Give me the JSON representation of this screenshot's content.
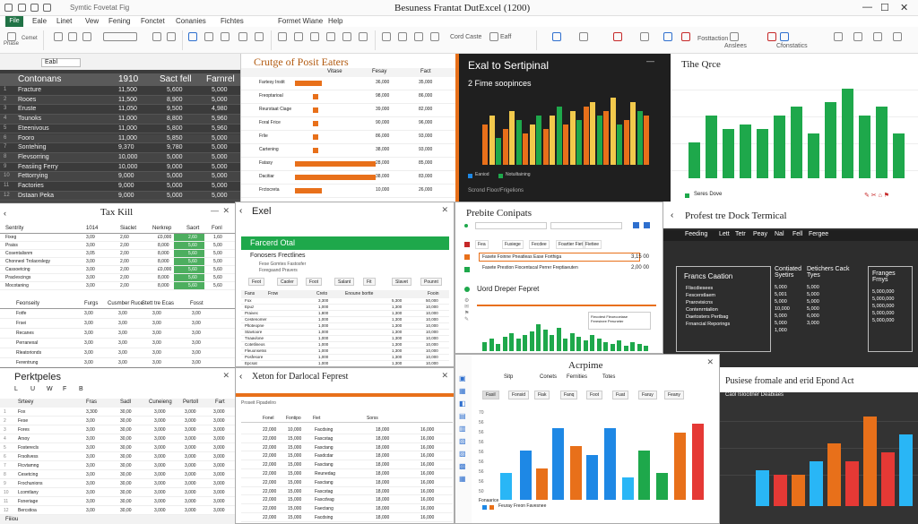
{
  "window": {
    "title": "Besuness Frantat DutExcel (1200)"
  },
  "menu": [
    "Eale",
    "Linet",
    "Vew",
    "Fening",
    "Fonctet",
    "Conanies",
    "Fichtes",
    "Formet Wiane",
    "Help"
  ],
  "menu_file": "File",
  "quick_access": "Symtic Fovetat Fig",
  "ribbon": {
    "left_labels": [
      "Pnase",
      "Cemet"
    ],
    "mid_labels": [
      "Cord Caste",
      "Eaff"
    ],
    "right_labels": [
      "Fosttaction",
      "Anslees",
      "Cfonstatics"
    ]
  },
  "panelA": {
    "name_box": "Eabl",
    "headers": [
      "Contonans",
      "1910",
      "Sact fell",
      "Farnrel"
    ],
    "rows": [
      [
        "Fracture",
        "11,500",
        "5,600",
        "5,000"
      ],
      [
        "Rooes",
        "11,500",
        "8,900",
        "5,000"
      ],
      [
        "Eruste",
        "11,050",
        "9,500",
        "4,980"
      ],
      [
        "Tounoks",
        "11,000",
        "8,800",
        "5,960"
      ],
      [
        "Eteenivous",
        "11,000",
        "5,800",
        "5,960"
      ],
      [
        "Fooro",
        "11,000",
        "5,850",
        "5,000"
      ],
      [
        "Sontehing",
        "9,370",
        "9,780",
        "5,000"
      ],
      [
        "Flevsorring",
        "10,000",
        "5,000",
        "5,000"
      ],
      [
        "Feasiing Ferry",
        "10,000",
        "9,000",
        "5,000"
      ],
      [
        "Fettorrying",
        "9,000",
        "5,000",
        "5,000"
      ],
      [
        "Factories",
        "9,000",
        "5,000",
        "5,000"
      ],
      [
        "Dstaan Peka",
        "9,000",
        "5,000",
        "5,000"
      ]
    ]
  },
  "panelB": {
    "title": "Crutge of Posit Eaters",
    "headers": [
      "Vitase",
      "Fesay",
      "Fact"
    ],
    "rows": [
      [
        "Fartesy Instit",
        "2,00",
        "36,000",
        "35,000"
      ],
      [
        "Freoptarioal",
        "2,00",
        "98,000",
        "86,000"
      ],
      [
        "Reurstaat Ciage",
        "2,00",
        "39,000",
        "82,000"
      ],
      [
        "Foral Frice",
        "2,00",
        "90,000",
        "96,000"
      ],
      [
        "Frlie",
        "2,00",
        "86,000",
        "93,000"
      ],
      [
        "Cartening",
        "2,00",
        "38,000",
        "93,000"
      ],
      [
        "Fatasy",
        "2,00",
        "28,000",
        "85,000"
      ],
      [
        "Dacitiar",
        "2,00",
        "38,000",
        "83,000"
      ],
      [
        "Frctocreta",
        "2,00",
        "10,000",
        "26,000"
      ]
    ]
  },
  "panelC": {
    "title": "Exal to Sertipinal",
    "subtitle": "2 Fime soopinces",
    "legend": [
      "Eaniod",
      "Notuiltaining"
    ],
    "footer": "Scrond Floor/Frigelions"
  },
  "panelD": {
    "title": "Tihe Qrce",
    "footer": "Seres Dove"
  },
  "panelE": {
    "title": "Tax Kill",
    "headers": [
      "Sentrity",
      "1014",
      "Siaclet",
      "Nerkrep",
      "Saort",
      "Fonl"
    ],
    "rows": [
      [
        "Fixeg",
        "3,09",
        "2,60",
        "£0,000",
        "2,60",
        "1,60"
      ],
      [
        "Praiss",
        "3,00",
        "2,00",
        "8,000",
        "5,60",
        "5,00"
      ],
      [
        "Cosentalisnm",
        "3,05",
        "2,00",
        "8,000",
        "5,60",
        "5,00"
      ],
      [
        "Chonneol Trolaorslegy",
        "3,00",
        "2,00",
        "8,000",
        "5,60",
        "5,00"
      ],
      [
        "Cassoetcing",
        "3,00",
        "2,00",
        "£0,000",
        "5,60",
        "5,60"
      ],
      [
        "Praclescings",
        "3,00",
        "2,00",
        "8,000",
        "5,60",
        "5,60"
      ],
      [
        "Mocotaning",
        "3,00",
        "2,00",
        "8,000",
        "5,60",
        "5,60"
      ]
    ],
    "sub_headers": [
      "Feonseity",
      "Furgs",
      "Cusmber Ruce",
      "Stett tre Ecas",
      "Fosst"
    ],
    "sub_rows": [
      [
        "Fotfe",
        "3,00",
        "3,00",
        "3,00",
        "3,00"
      ],
      [
        "Frsei",
        "3,00",
        "3,00",
        "3,00",
        "3,00"
      ],
      [
        "Recanes",
        "3,00",
        "3,00",
        "3,00",
        "3,00"
      ],
      [
        "Perranexal",
        "3,00",
        "3,00",
        "3,00",
        "3,00"
      ],
      [
        "Rleatorionds",
        "3,00",
        "3,00",
        "3,00",
        "3,00"
      ],
      [
        "Ferentrung",
        "3,00",
        "3,00",
        "3,00",
        "3,00"
      ]
    ]
  },
  "panelF": {
    "title": "Exel",
    "banner": "Farcerd Otal",
    "subtitle": "Fonosers Frectlines",
    "note1": "Fese Gomtes Fastosfer",
    "note2": "Foregaand Pravers",
    "tabs": [
      "Feot",
      "Caoler",
      "Foot",
      "Salant",
      "Fit",
      "Slavet",
      "Pounnt"
    ],
    "headers": [
      "Fans",
      "Frow",
      "Creto",
      "Enoune bortte",
      "Fooin"
    ],
    "rows": [
      [
        "Fox",
        "3,300",
        "5,300",
        "50,000"
      ],
      [
        "Epuz",
        "1,000",
        "1,300",
        "10,000"
      ],
      [
        "Praivec",
        "1,800",
        "1,300",
        "10,000"
      ],
      [
        "Cestenomer",
        "1,000",
        "1,300",
        "10,000"
      ],
      [
        "Pltoteopne",
        "1,000",
        "1,300",
        "10,000"
      ],
      [
        "Stavtoore",
        "1,000",
        "1,300",
        "10,000"
      ],
      [
        "Tnaavlone",
        "1,000",
        "1,300",
        "10,000"
      ],
      [
        "Cotetlineos",
        "1,000",
        "1,300",
        "10,000"
      ],
      [
        "Fleuonsetss",
        "1,000",
        "1,300",
        "10,000"
      ],
      [
        "Posfesore",
        "1,000",
        "1,300",
        "10,000"
      ],
      [
        "Epcsat",
        "1,000",
        "1,300",
        "10,000"
      ]
    ]
  },
  "panelG": {
    "title": "Prebite Conipats",
    "nav": [
      "Fea",
      "Fusiege",
      "Fecdee",
      "Foartier Fiet",
      "Fietiee"
    ],
    "lines": [
      [
        "Fasete Foinne Pneatleas Ease Forthiga",
        "3,15 00"
      ],
      [
        "Fasete Prestion Fiocentacal Perrer Freptiaeuten",
        "2,00 00"
      ]
    ],
    "section": "Uord Dreper Fepret",
    "legend": [
      "Fiecotest Fleoecoeiase",
      "Feresinee Peruneter"
    ]
  },
  "panelH": {
    "title": "Profest tre Dock Termical",
    "menu": [
      "Feeding",
      "Lett",
      "Tetr",
      "Peay",
      "Nal",
      "Fell",
      "Fergee"
    ],
    "box1_title": "Francs Caation",
    "box1_rows": [
      "Fliscdiesees",
      "Fescerstlaem",
      "Prarovisicns",
      "Contenrntalion",
      "Daetosters Pertbag",
      "Frnancial Reporings"
    ],
    "box2_title": "Contiated Syetirs",
    "box2_vals": [
      "5,000",
      "5,001",
      "5,000",
      "10,000",
      "5,000",
      "5,000",
      "1,000"
    ],
    "box3_title": "Detichers Cack Tyes",
    "box3_vals": [
      "5,000",
      "5,000",
      "5,000",
      "5,000",
      "6,000",
      "3,000"
    ],
    "box4_title": "Franges Frnys",
    "box4_vals": [
      "5,000,000",
      "5,000,000",
      "5,000,000",
      "5,000,000",
      "5,000,000"
    ]
  },
  "panelI": {
    "title": "Perktpeles",
    "tools": [
      "L",
      "U",
      "W",
      "F",
      "B"
    ],
    "headers": [
      "Srteey",
      "Fras",
      "Sadl",
      "Cuneieng",
      "Pertoll",
      "Fart"
    ],
    "rows": [
      [
        "Fox",
        "3,300",
        "30,00",
        "3,000",
        "3,000",
        "3,000"
      ],
      [
        "Fese",
        "3,00",
        "30,00",
        "3,000",
        "3,000",
        "3,000"
      ],
      [
        "Fores",
        "3,00",
        "30,00",
        "3,000",
        "3,000",
        "3,000"
      ],
      [
        "Arsoy",
        "3,00",
        "30,00",
        "3,000",
        "3,000",
        "3,000"
      ],
      [
        "Fosterecls",
        "3,00",
        "30,00",
        "3,000",
        "3,000",
        "3,000"
      ],
      [
        "Frsolivess",
        "3,00",
        "30,00",
        "3,000",
        "3,000",
        "3,000"
      ],
      [
        "Ftcvtamng",
        "3,00",
        "30,00",
        "3,000",
        "3,000",
        "3,000"
      ],
      [
        "Cesetcing",
        "3,00",
        "30,00",
        "3,000",
        "3,000",
        "3,000"
      ],
      [
        "Frochunions",
        "3,00",
        "30,00",
        "3,000",
        "3,000",
        "3,000"
      ],
      [
        "Lcomtlany",
        "3,00",
        "30,00",
        "3,000",
        "3,000",
        "3,000"
      ],
      [
        "Fsneriage",
        "3,00",
        "30,00",
        "3,000",
        "3,000",
        "3,000"
      ],
      [
        "Bercstioa",
        "3,00",
        "30,00",
        "3,000",
        "3,000",
        "3,000"
      ]
    ],
    "status": "Fiiiou"
  },
  "panelJ": {
    "title": "Xeton for Darlocal Feprest",
    "sub": "Proseit Fipadeliro",
    "headers": [
      "Fonel",
      "Fontipo",
      "Fiet",
      "Sorss"
    ],
    "rows": [
      [
        "22,000",
        "10,000",
        "Facdsing",
        "18,000",
        "16,000"
      ],
      [
        "22,000",
        "15,000",
        "Fascstag",
        "18,000",
        "16,000"
      ],
      [
        "22,000",
        "15,000",
        "Fasctang",
        "18,000",
        "16,000"
      ],
      [
        "22,000",
        "15,000",
        "Fasdcdar",
        "18,000",
        "16,000"
      ],
      [
        "22,000",
        "15,000",
        "Fasctang",
        "18,000",
        "16,000"
      ],
      [
        "22,000",
        "15,000",
        "Reunedag",
        "18,000",
        "16,000"
      ],
      [
        "22,000",
        "15,000",
        "Fasctang",
        "18,000",
        "16,000"
      ],
      [
        "22,000",
        "15,000",
        "Fascstag",
        "18,000",
        "16,000"
      ],
      [
        "22,000",
        "15,000",
        "Fascdvag",
        "18,000",
        "16,000"
      ],
      [
        "22,000",
        "15,000",
        "Faectang",
        "18,000",
        "16,000"
      ],
      [
        "22,000",
        "15,000",
        "Facdsing",
        "18,000",
        "16,000"
      ]
    ]
  },
  "panelK": {
    "title": "Acrpime",
    "nav": [
      "Sitp",
      "Conets",
      "Fernities",
      "Totes"
    ],
    "tabs": [
      "Fasil",
      "Fonsid",
      "Fiak",
      "Fanq",
      "Foot",
      "Fuat",
      "Faruy",
      "Feany"
    ],
    "footer": "Fonaarice",
    "legend": [
      "Feuray Freon Favesnee"
    ],
    "y_ticks": [
      "70",
      "56",
      "56",
      "56",
      "56",
      "56",
      "56",
      "56",
      "50"
    ]
  },
  "panelL": {
    "title": "Pusiese fromale and erid Epond Act",
    "subtitle": "Caol Islocitner Deabiaes"
  },
  "colors": {
    "excel_green": "#217346",
    "orange": "#e8701a",
    "green": "#1ea84b",
    "blue": "#1e88e5",
    "cyan": "#29b6f6",
    "red": "#e53935"
  }
}
